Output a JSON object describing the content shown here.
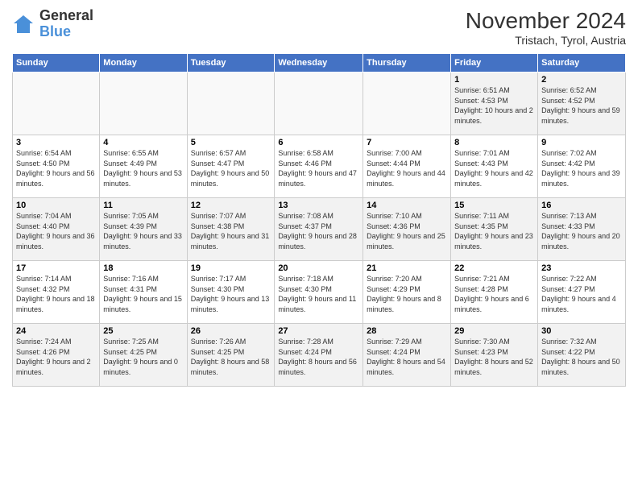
{
  "logo": {
    "line1": "General",
    "line2": "Blue"
  },
  "title": "November 2024",
  "subtitle": "Tristach, Tyrol, Austria",
  "days_of_week": [
    "Sunday",
    "Monday",
    "Tuesday",
    "Wednesday",
    "Thursday",
    "Friday",
    "Saturday"
  ],
  "weeks": [
    [
      {
        "day": "",
        "info": ""
      },
      {
        "day": "",
        "info": ""
      },
      {
        "day": "",
        "info": ""
      },
      {
        "day": "",
        "info": ""
      },
      {
        "day": "",
        "info": ""
      },
      {
        "day": "1",
        "info": "Sunrise: 6:51 AM\nSunset: 4:53 PM\nDaylight: 10 hours and 2 minutes."
      },
      {
        "day": "2",
        "info": "Sunrise: 6:52 AM\nSunset: 4:52 PM\nDaylight: 9 hours and 59 minutes."
      }
    ],
    [
      {
        "day": "3",
        "info": "Sunrise: 6:54 AM\nSunset: 4:50 PM\nDaylight: 9 hours and 56 minutes."
      },
      {
        "day": "4",
        "info": "Sunrise: 6:55 AM\nSunset: 4:49 PM\nDaylight: 9 hours and 53 minutes."
      },
      {
        "day": "5",
        "info": "Sunrise: 6:57 AM\nSunset: 4:47 PM\nDaylight: 9 hours and 50 minutes."
      },
      {
        "day": "6",
        "info": "Sunrise: 6:58 AM\nSunset: 4:46 PM\nDaylight: 9 hours and 47 minutes."
      },
      {
        "day": "7",
        "info": "Sunrise: 7:00 AM\nSunset: 4:44 PM\nDaylight: 9 hours and 44 minutes."
      },
      {
        "day": "8",
        "info": "Sunrise: 7:01 AM\nSunset: 4:43 PM\nDaylight: 9 hours and 42 minutes."
      },
      {
        "day": "9",
        "info": "Sunrise: 7:02 AM\nSunset: 4:42 PM\nDaylight: 9 hours and 39 minutes."
      }
    ],
    [
      {
        "day": "10",
        "info": "Sunrise: 7:04 AM\nSunset: 4:40 PM\nDaylight: 9 hours and 36 minutes."
      },
      {
        "day": "11",
        "info": "Sunrise: 7:05 AM\nSunset: 4:39 PM\nDaylight: 9 hours and 33 minutes."
      },
      {
        "day": "12",
        "info": "Sunrise: 7:07 AM\nSunset: 4:38 PM\nDaylight: 9 hours and 31 minutes."
      },
      {
        "day": "13",
        "info": "Sunrise: 7:08 AM\nSunset: 4:37 PM\nDaylight: 9 hours and 28 minutes."
      },
      {
        "day": "14",
        "info": "Sunrise: 7:10 AM\nSunset: 4:36 PM\nDaylight: 9 hours and 25 minutes."
      },
      {
        "day": "15",
        "info": "Sunrise: 7:11 AM\nSunset: 4:35 PM\nDaylight: 9 hours and 23 minutes."
      },
      {
        "day": "16",
        "info": "Sunrise: 7:13 AM\nSunset: 4:33 PM\nDaylight: 9 hours and 20 minutes."
      }
    ],
    [
      {
        "day": "17",
        "info": "Sunrise: 7:14 AM\nSunset: 4:32 PM\nDaylight: 9 hours and 18 minutes."
      },
      {
        "day": "18",
        "info": "Sunrise: 7:16 AM\nSunset: 4:31 PM\nDaylight: 9 hours and 15 minutes."
      },
      {
        "day": "19",
        "info": "Sunrise: 7:17 AM\nSunset: 4:30 PM\nDaylight: 9 hours and 13 minutes."
      },
      {
        "day": "20",
        "info": "Sunrise: 7:18 AM\nSunset: 4:30 PM\nDaylight: 9 hours and 11 minutes."
      },
      {
        "day": "21",
        "info": "Sunrise: 7:20 AM\nSunset: 4:29 PM\nDaylight: 9 hours and 8 minutes."
      },
      {
        "day": "22",
        "info": "Sunrise: 7:21 AM\nSunset: 4:28 PM\nDaylight: 9 hours and 6 minutes."
      },
      {
        "day": "23",
        "info": "Sunrise: 7:22 AM\nSunset: 4:27 PM\nDaylight: 9 hours and 4 minutes."
      }
    ],
    [
      {
        "day": "24",
        "info": "Sunrise: 7:24 AM\nSunset: 4:26 PM\nDaylight: 9 hours and 2 minutes."
      },
      {
        "day": "25",
        "info": "Sunrise: 7:25 AM\nSunset: 4:25 PM\nDaylight: 9 hours and 0 minutes."
      },
      {
        "day": "26",
        "info": "Sunrise: 7:26 AM\nSunset: 4:25 PM\nDaylight: 8 hours and 58 minutes."
      },
      {
        "day": "27",
        "info": "Sunrise: 7:28 AM\nSunset: 4:24 PM\nDaylight: 8 hours and 56 minutes."
      },
      {
        "day": "28",
        "info": "Sunrise: 7:29 AM\nSunset: 4:24 PM\nDaylight: 8 hours and 54 minutes."
      },
      {
        "day": "29",
        "info": "Sunrise: 7:30 AM\nSunset: 4:23 PM\nDaylight: 8 hours and 52 minutes."
      },
      {
        "day": "30",
        "info": "Sunrise: 7:32 AM\nSunset: 4:22 PM\nDaylight: 8 hours and 50 minutes."
      }
    ]
  ]
}
